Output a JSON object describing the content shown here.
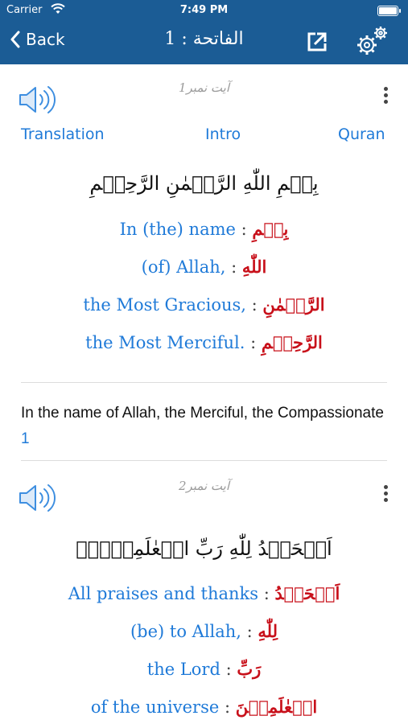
{
  "status_bar": {
    "carrier": "Carrier",
    "time": "7:49 PM"
  },
  "nav": {
    "back_label": "Back",
    "title": "الفاتحة : 1"
  },
  "tabs": {
    "translation": "Translation",
    "intro": "Intro",
    "quran": "Quran"
  },
  "verses": [
    {
      "number_label": "آیت نمبر1",
      "arabic": "بِسۡمِ اللّٰهِ الرَّحۡمٰنِ الرَّحِيۡمِ",
      "words": [
        {
          "en": "In (the) name",
          "ar": "بِسۡمِ"
        },
        {
          "en": "(of) Allah,",
          "ar": "اللّٰهِ"
        },
        {
          "en": "the Most Gracious,",
          "ar": "الرَّحۡمٰنِ"
        },
        {
          "en": "the Most Merciful.",
          "ar": "الرَّحِيۡمِ"
        }
      ],
      "translation": "In the name of Allah, the Merciful, the Compassionate",
      "footnote": "1"
    },
    {
      "number_label": "آیت نمبر2",
      "arabic": "اَلۡحَمۡدُ لِلّٰهِ رَبِّ الۡعٰلَمِيۡنَۙ",
      "words": [
        {
          "en": "All praises and thanks",
          "ar": "اَلۡحَمۡدُ"
        },
        {
          "en": "(be) to Allah,",
          "ar": "لِلّٰهِ"
        },
        {
          "en": "the Lord",
          "ar": "رَبِّ"
        },
        {
          "en": "of the universe",
          "ar": "الۡعٰلَمِيۡنَ"
        }
      ]
    }
  ],
  "colors": {
    "header": "#1b5c95",
    "english": "#1f7ad8",
    "arabic_word": "#c8101a"
  },
  "icons": [
    "wifi-icon",
    "battery-icon",
    "back-chevron-icon",
    "share-icon",
    "settings-gear-icon",
    "speaker-icon",
    "more-vertical-icon"
  ]
}
